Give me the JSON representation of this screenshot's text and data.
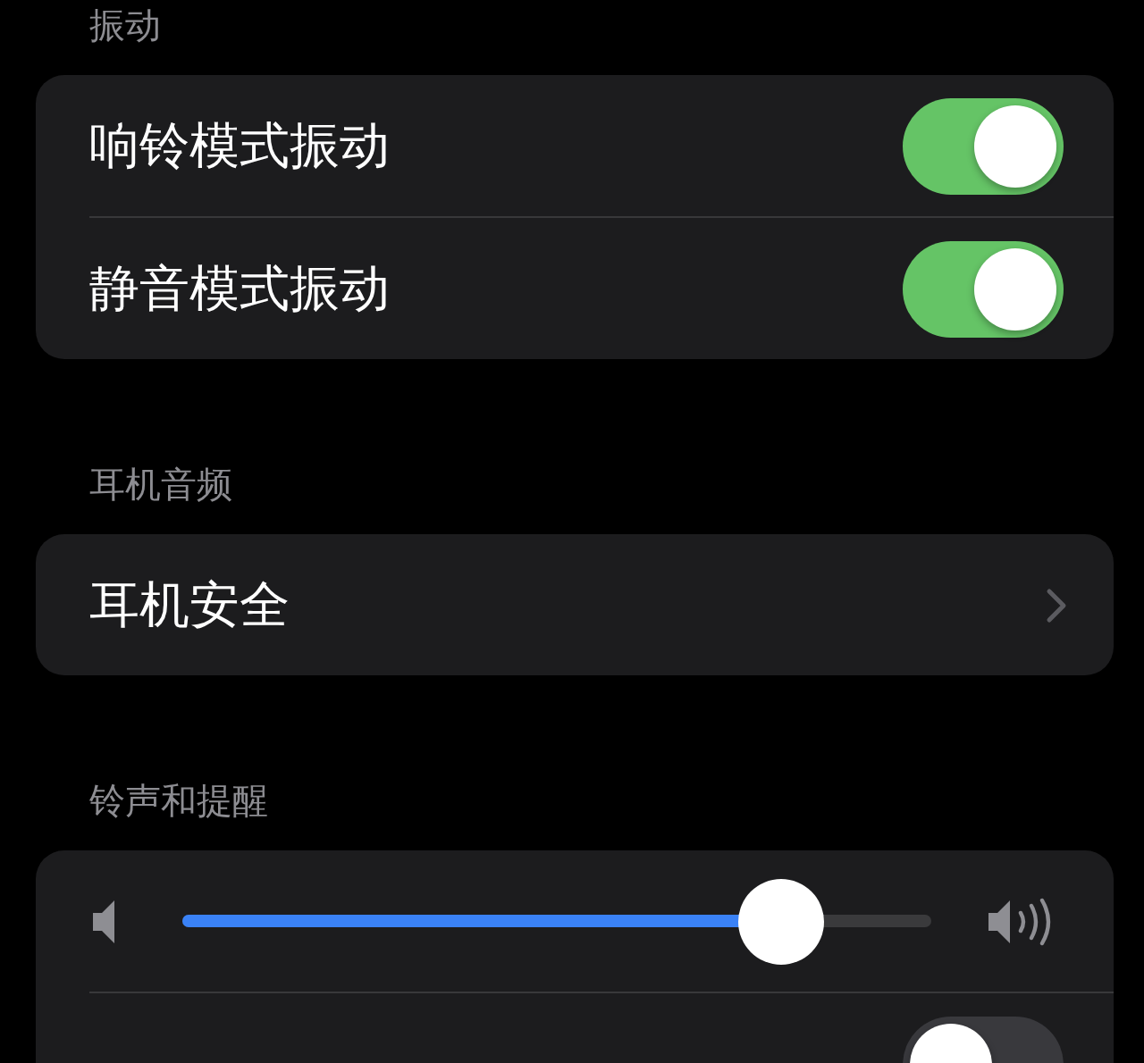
{
  "sections": [
    {
      "header": "振动",
      "rows": [
        {
          "kind": "toggle",
          "label": "响铃模式振动",
          "on": true
        },
        {
          "kind": "toggle",
          "label": "静音模式振动",
          "on": true
        }
      ]
    },
    {
      "header": "耳机音频",
      "rows": [
        {
          "kind": "link",
          "label": "耳机安全"
        }
      ]
    },
    {
      "header": "铃声和提醒",
      "rows": [
        {
          "kind": "slider",
          "level": 0.8
        },
        {
          "kind": "toggle",
          "on": false
        }
      ]
    }
  ]
}
